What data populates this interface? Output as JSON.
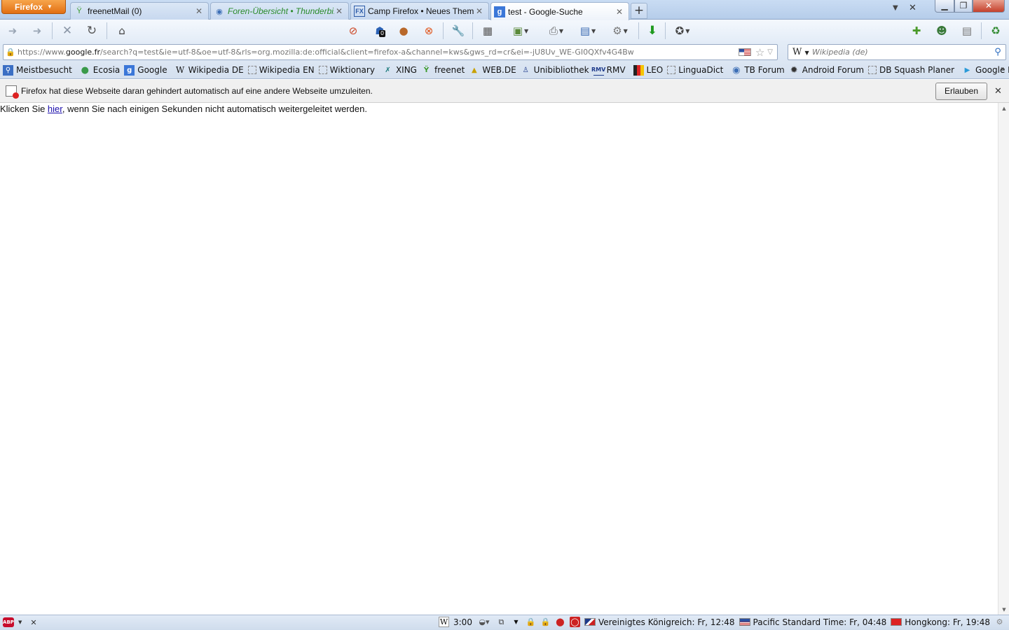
{
  "browser": {
    "menu_button": "Firefox",
    "tabs": [
      {
        "label": "freenetMail (0)",
        "favicon": "freenet-icon",
        "selected": false
      },
      {
        "label": "Foren-Übersicht • Thunderbi...",
        "favicon": "thunderbird-forum-icon",
        "selected": false
      },
      {
        "label": "Camp Firefox • Neues Them...",
        "favicon": "camp-firefox-icon",
        "selected": false
      },
      {
        "label": "test - Google-Suche",
        "favicon": "google-icon",
        "selected": true
      }
    ],
    "new_tab": "+",
    "address": {
      "prefix": "https://www.",
      "domain": "google.fr",
      "path": "/search?q=test&ie=utf-8&oe=utf-8&rls=org.mozilla:de:official&client=firefox-a&channel=kws&gws_rd=cr&ei=-jU8Uv_WE-GI0QXfv4G4Bw"
    },
    "search": {
      "engine": "W",
      "placeholder": "Wikipedia (de)"
    },
    "toolbar_badge": "0"
  },
  "bookmarks": [
    {
      "label": "Meistbesucht",
      "icon": "most-visited-icon"
    },
    {
      "label": "Ecosia",
      "icon": "globe-icon"
    },
    {
      "label": "Google",
      "icon": "google-icon"
    },
    {
      "label": "Wikipedia DE",
      "icon": "wikipedia-icon"
    },
    {
      "label": "Wikipedia EN",
      "icon": "blank-page-icon"
    },
    {
      "label": "Wiktionary",
      "icon": "blank-page-icon"
    },
    {
      "label": "XING",
      "icon": "xing-icon"
    },
    {
      "label": "freenet",
      "icon": "freenet-icon"
    },
    {
      "label": "WEB.DE",
      "icon": "webde-icon"
    },
    {
      "label": "Unibibliothek",
      "icon": "library-icon"
    },
    {
      "label": "RMV",
      "icon": "rmv-icon"
    },
    {
      "label": "LEO",
      "icon": "leo-icon"
    },
    {
      "label": "LinguaDict",
      "icon": "blank-page-icon"
    },
    {
      "label": "TB Forum",
      "icon": "thunderbird-icon"
    },
    {
      "label": "Android Forum",
      "icon": "android-icon"
    },
    {
      "label": "DB Squash Planer",
      "icon": "blank-page-icon"
    },
    {
      "label": "Google Play",
      "icon": "google-play-icon"
    }
  ],
  "notification": {
    "text": "Firefox hat diese Webseite daran gehindert automatisch auf eine andere Webseite umzuleiten.",
    "allow_button": "Erlauben"
  },
  "content": {
    "before_link": "Klicken Sie ",
    "link": "hier",
    "after_link": ", wenn Sie nach einigen Sekunden nicht automatisch weitergeleitet werden."
  },
  "statusbar": {
    "time_value": "3:00",
    "clocks": [
      {
        "label": "Vereinigtes Königreich: Fr, 12:48",
        "flag": "uk-flag"
      },
      {
        "label": "Pacific Standard Time: Fr, 04:48",
        "flag": "us-flag"
      },
      {
        "label": "Hongkong: Fr, 19:48",
        "flag": "hk-flag"
      }
    ]
  },
  "colors": {
    "accent": "#e26f12",
    "link": "#1a0dab",
    "chrome": "#dce6f3"
  }
}
